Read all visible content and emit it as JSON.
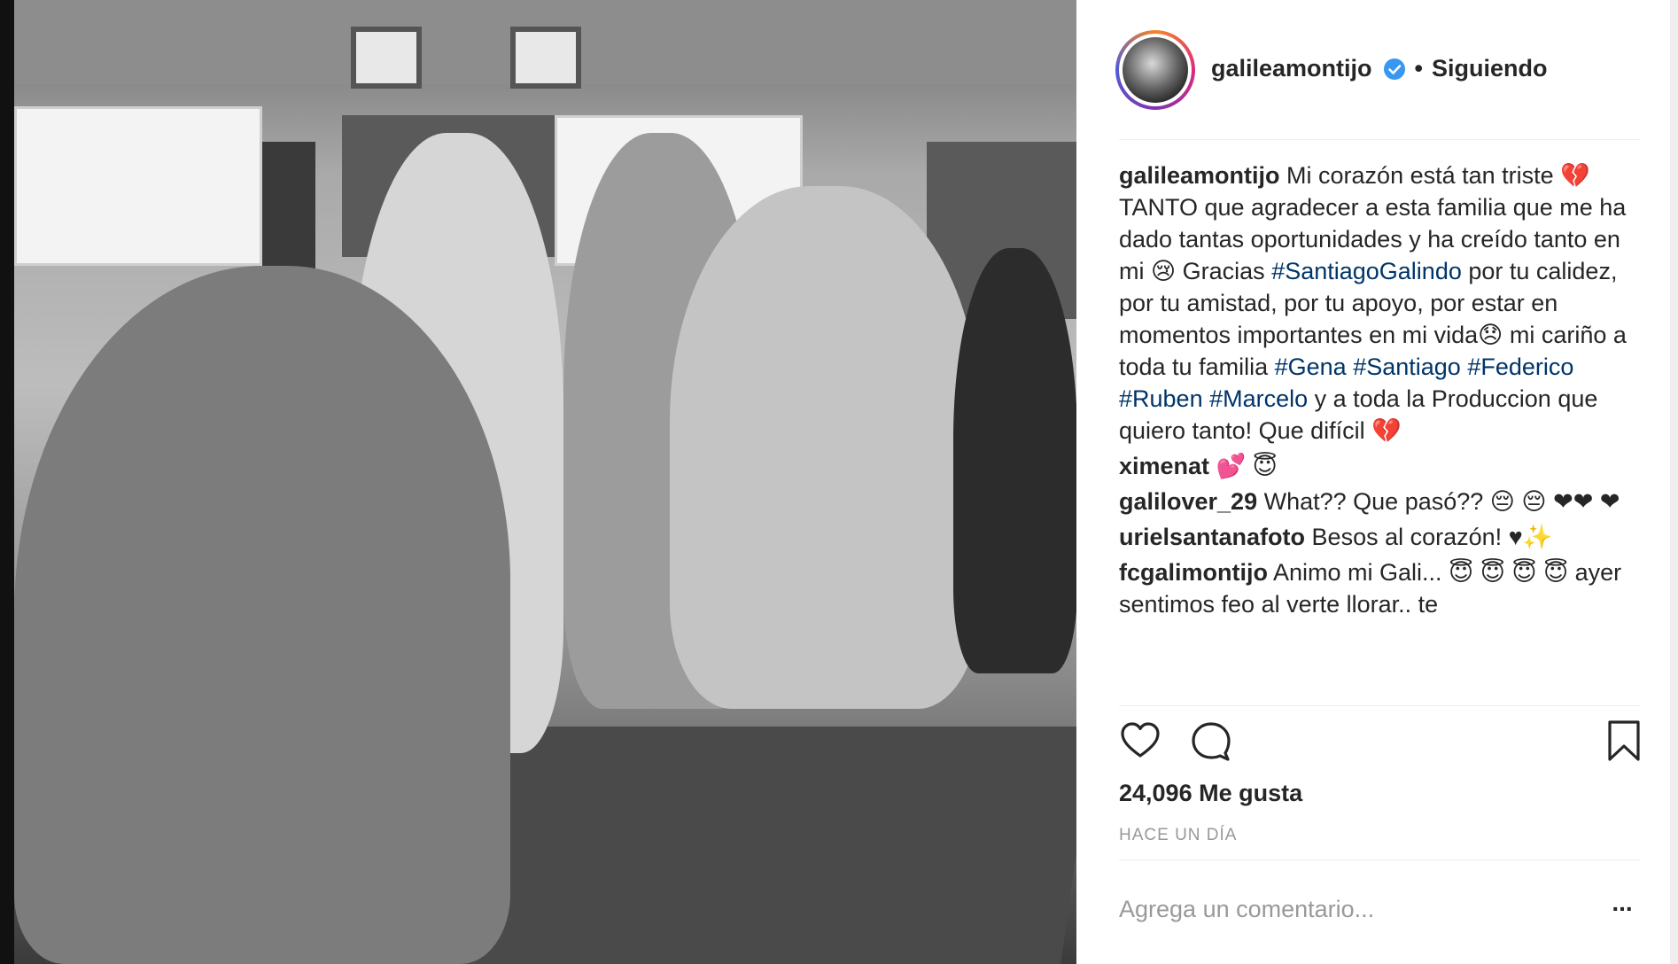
{
  "post": {
    "image_alt": "",
    "header": {
      "username": "galileamontijo",
      "separator": "•",
      "follow_label": "Siguiendo"
    },
    "caption": {
      "username": "galileamontijo",
      "parts": [
        "Mi corazón está tan triste ",
        "💔",
        " TANTO que agradecer a esta familia que me ha dado tantas oportunidades y ha creído tanto en mi ",
        "😢",
        " Gracias ",
        "#SantiagoGalindo",
        " por tu calidez, por tu amistad, por tu apoyo, por estar en momentos importantes en mi vida",
        "😞",
        "  mi cariño a toda tu familia ",
        "#Gena",
        " ",
        "#Santiago",
        " ",
        "#Federico",
        " ",
        "#Ruben",
        " ",
        "#Marcelo",
        " y a toda la Produccion que quiero tanto! Que difícil ",
        "💔"
      ]
    },
    "comments": [
      {
        "username": "ximenat",
        "text": "💕 😇"
      },
      {
        "username": "galilover_29",
        "text": "What?? Que pasó?? 😔 😔 ❤❤ ❤"
      },
      {
        "username": "urielsantanafoto",
        "text": "Besos al corazón! ♥✨"
      },
      {
        "username": "fcgalimontijo",
        "text": "Animo mi Gali... 😇 😇 😇 😇 ayer sentimos feo al verte llorar.. te"
      }
    ],
    "likes": "24,096 Me gusta",
    "timestamp": "HACE UN DÍA",
    "comment_placeholder": "Agrega un comentario...",
    "more_label": "..."
  },
  "colors": {
    "hashtag": "#003569",
    "text": "#262626",
    "muted": "#999999",
    "verified": "#3897f0"
  }
}
